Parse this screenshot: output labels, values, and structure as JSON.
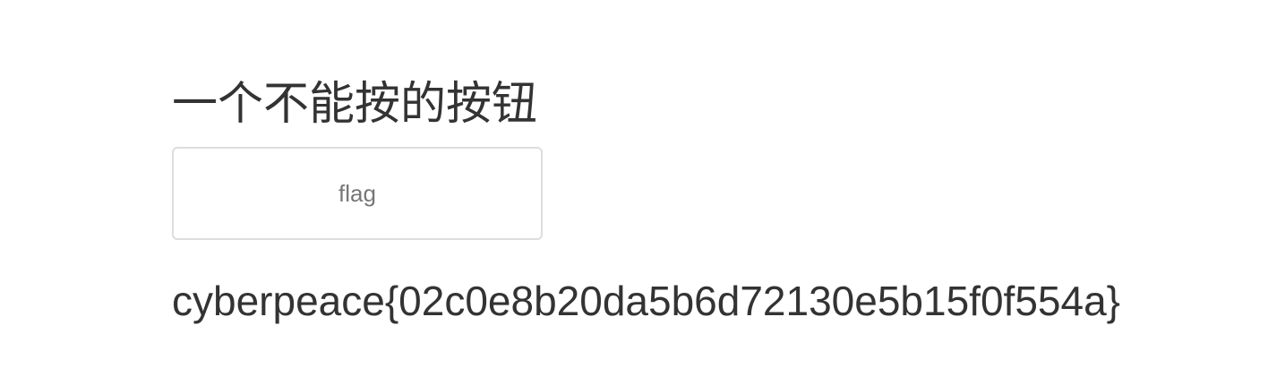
{
  "page": {
    "title": "一个不能按的按钮",
    "button_label": "flag",
    "flag_value": "cyberpeace{02c0e8b20da5b6d72130e5b15f0f554a}"
  }
}
